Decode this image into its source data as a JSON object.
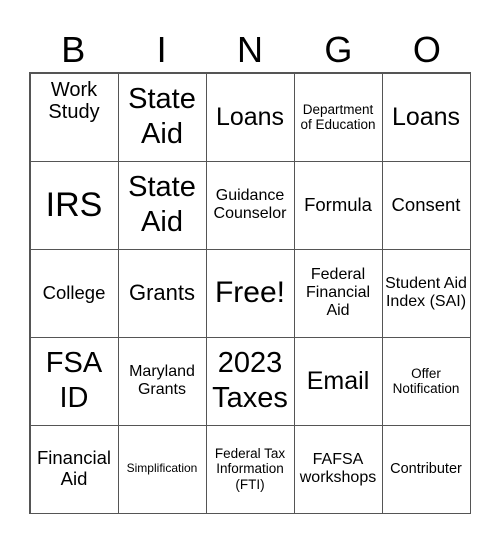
{
  "header": [
    "B",
    "I",
    "N",
    "G",
    "O"
  ],
  "cells": [
    "Work Study",
    "State Aid",
    "Loans",
    "Department of Education",
    "Loans",
    "IRS",
    "State Aid",
    "Guidance Counselor",
    "Formula",
    "Consent",
    "College",
    "Grants",
    "Free!",
    "Federal Financial Aid",
    "Student Aid Index (SAI)",
    "FSA ID",
    "Maryland Grants",
    "2023 Taxes",
    "Email",
    "Offer Notification",
    "Financial Aid",
    "Simplification",
    "Federal Tax Information (FTI)",
    "FAFSA workshops",
    "Contributer"
  ]
}
